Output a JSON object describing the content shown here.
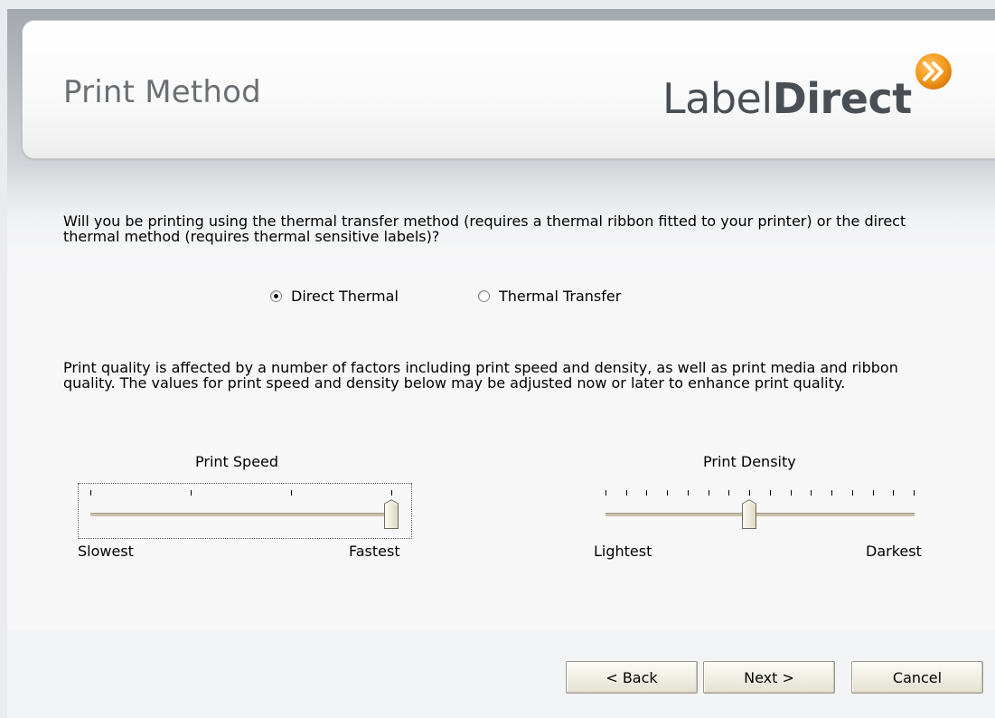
{
  "header": {
    "title": "Print Method",
    "logo_text_light": "Label",
    "logo_text_bold": "Direct"
  },
  "question": "Will you be printing using the thermal transfer method (requires a thermal ribbon fitted to your printer) or the direct thermal method (requires thermal sensitive labels)?",
  "print_method": {
    "options": [
      {
        "label": "Direct Thermal",
        "selected": true
      },
      {
        "label": "Thermal Transfer",
        "selected": false
      }
    ]
  },
  "quality_note": "Print quality is affected by a number of factors including print speed and density, as well as print media and ribbon quality. The values for print speed and density below may be adjusted now or later to enhance print quality.",
  "print_speed": {
    "label": "Print Speed",
    "min_label": "Slowest",
    "max_label": "Fastest",
    "tick_count": 4,
    "value_fraction": 1.0
  },
  "print_density": {
    "label": "Print Density",
    "min_label": "Lightest",
    "max_label": "Darkest",
    "tick_count": 16,
    "value_fraction": 0.467
  },
  "buttons": {
    "back": "< Back",
    "next": "Next >",
    "cancel": "Cancel"
  },
  "colors": {
    "accent_orange": "#f39a1e",
    "track": "#c8c0a8",
    "title_gray": "#6b6f73"
  }
}
